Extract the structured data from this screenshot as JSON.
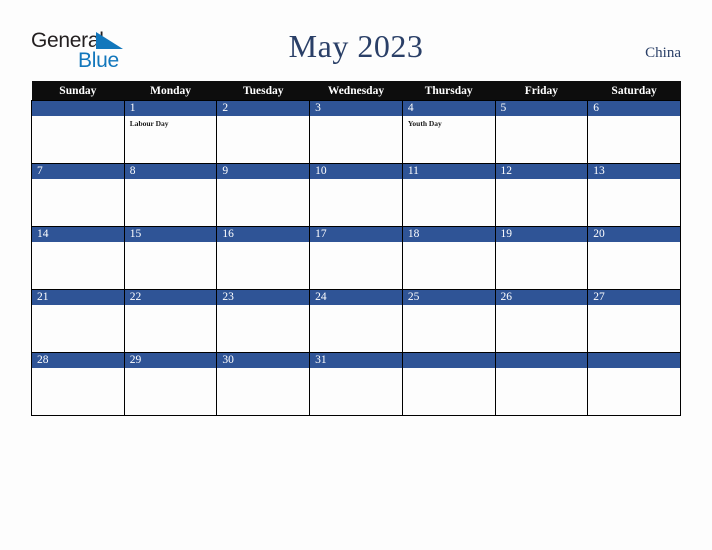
{
  "logo": {
    "part1": "General",
    "part2": "Blue",
    "triangle_color": "#1277bc",
    "text_color": "#231f20"
  },
  "header": {
    "title": "May 2023",
    "country": "China",
    "title_color": "#2a3f67"
  },
  "calendar": {
    "header_bg": "#0d0d0d",
    "daynum_bg": "#2f5496",
    "weekdays": [
      "Sunday",
      "Monday",
      "Tuesday",
      "Wednesday",
      "Thursday",
      "Friday",
      "Saturday"
    ],
    "weeks": [
      [
        {
          "day": "",
          "events": []
        },
        {
          "day": "1",
          "events": [
            "Labour Day"
          ]
        },
        {
          "day": "2",
          "events": []
        },
        {
          "day": "3",
          "events": []
        },
        {
          "day": "4",
          "events": [
            "Youth Day"
          ]
        },
        {
          "day": "5",
          "events": []
        },
        {
          "day": "6",
          "events": []
        }
      ],
      [
        {
          "day": "7",
          "events": []
        },
        {
          "day": "8",
          "events": []
        },
        {
          "day": "9",
          "events": []
        },
        {
          "day": "10",
          "events": []
        },
        {
          "day": "11",
          "events": []
        },
        {
          "day": "12",
          "events": []
        },
        {
          "day": "13",
          "events": []
        }
      ],
      [
        {
          "day": "14",
          "events": []
        },
        {
          "day": "15",
          "events": []
        },
        {
          "day": "16",
          "events": []
        },
        {
          "day": "17",
          "events": []
        },
        {
          "day": "18",
          "events": []
        },
        {
          "day": "19",
          "events": []
        },
        {
          "day": "20",
          "events": []
        }
      ],
      [
        {
          "day": "21",
          "events": []
        },
        {
          "day": "22",
          "events": []
        },
        {
          "day": "23",
          "events": []
        },
        {
          "day": "24",
          "events": []
        },
        {
          "day": "25",
          "events": []
        },
        {
          "day": "26",
          "events": []
        },
        {
          "day": "27",
          "events": []
        }
      ],
      [
        {
          "day": "28",
          "events": []
        },
        {
          "day": "29",
          "events": []
        },
        {
          "day": "30",
          "events": []
        },
        {
          "day": "31",
          "events": []
        },
        {
          "day": "",
          "events": []
        },
        {
          "day": "",
          "events": []
        },
        {
          "day": "",
          "events": []
        }
      ]
    ]
  }
}
